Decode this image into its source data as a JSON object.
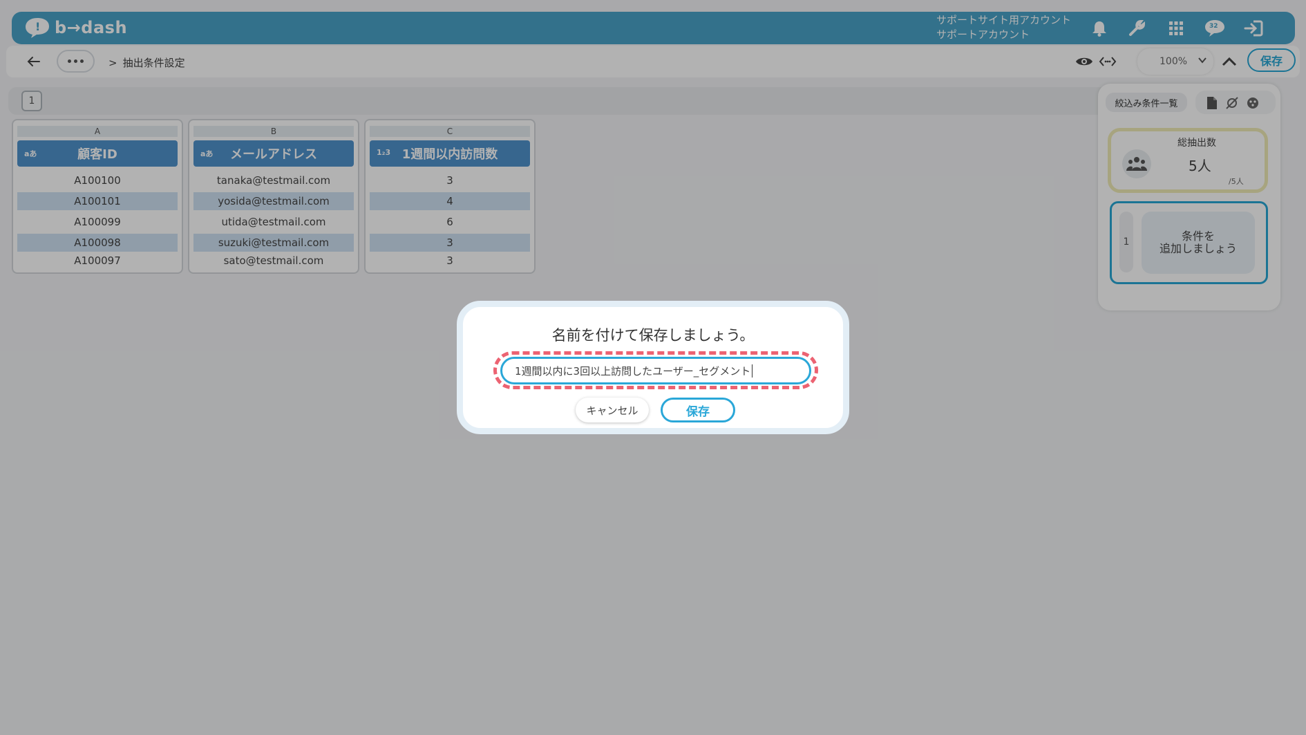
{
  "header": {
    "logo_text": "b→dash",
    "account_line1": "サポートサイト用アカウント",
    "account_line2": "サポートアカウント",
    "icons": [
      "bell-icon",
      "wrench-icon",
      "grid-icon",
      "chat-icon",
      "logout-icon"
    ],
    "chat_badge": "32"
  },
  "subbar": {
    "breadcrumb_sep": ">",
    "breadcrumb_current": "抽出条件設定",
    "zoom_value": "100%",
    "save_label": "保存"
  },
  "pages": [
    "1"
  ],
  "columns": [
    {
      "letter": "A",
      "type_badge": "aあ",
      "title": "顧客ID",
      "cells": [
        "A100100",
        "A100101",
        "A100099",
        "A100098",
        "A100097"
      ]
    },
    {
      "letter": "B",
      "type_badge": "aあ",
      "title": "メールアドレス",
      "cells": [
        "tanaka@testmail.com",
        "yosida@testmail.com",
        "utida@testmail.com",
        "suzuki@testmail.com",
        "sato@testmail.com"
      ]
    },
    {
      "letter": "C",
      "type_badge": "1₂3",
      "title": "1週間以内訪問数",
      "cells": [
        "3",
        "4",
        "6",
        "3",
        "3"
      ]
    }
  ],
  "side_panel": {
    "filter_list_label": "絞込み条件一覧",
    "count_label": "総抽出数",
    "count_value": "5人",
    "count_sub": "/5人",
    "condition_number": "1",
    "add_condition_label": "条件を\n追加しましょう"
  },
  "modal": {
    "title": "名前を付けて保存しましょう。",
    "input_value": "1週間以内に3回以上訪問したユーザー_セグメント",
    "cancel_label": "キャンセル",
    "save_label": "保存"
  },
  "colors": {
    "header_bg": "#4aa3c8",
    "accent": "#27a6d4",
    "column_header": "#4f92cc",
    "highlight_ring": "#ec6372"
  }
}
